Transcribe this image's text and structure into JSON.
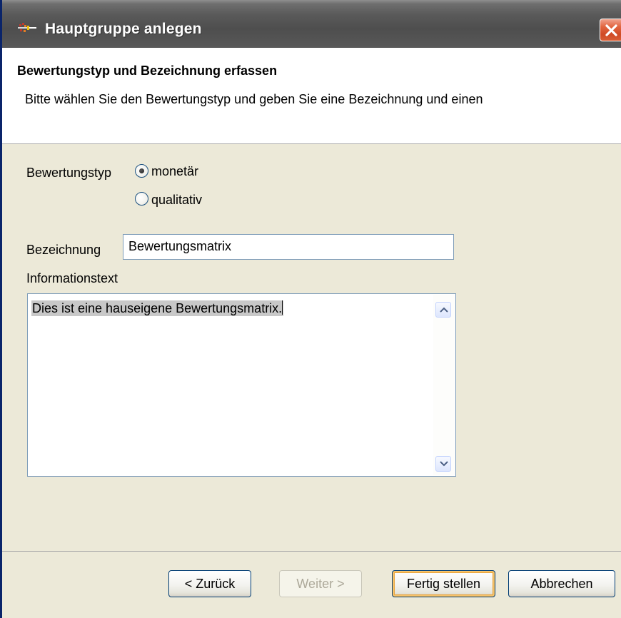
{
  "window": {
    "title": "Hauptgruppe anlegen",
    "close_glyph": "✕"
  },
  "header": {
    "title": "Bewertungstyp und Bezeichnung erfassen",
    "description": "Bitte wählen Sie den Bewertungstyp und geben Sie eine Bezeichnung und einen"
  },
  "form": {
    "bewertungstyp_label": "Bewertungstyp",
    "options": [
      {
        "label": "monetär",
        "selected": true
      },
      {
        "label": "qualitativ",
        "selected": false
      }
    ],
    "bezeichnung_label": "Bezeichnung",
    "bezeichnung_value": "Bewertungsmatrix",
    "info_label": "Informationstext",
    "info_value": "Dies ist eine hauseigene Bewertungsmatrix."
  },
  "buttons": {
    "back": "< Zurück",
    "next": "Weiter >",
    "finish": "Fertig stellen",
    "cancel": "Abbrechen"
  },
  "icons": {
    "app": "app-icon",
    "close": "close-icon",
    "scroll_up": "chevron-up-icon",
    "scroll_down": "chevron-down-icon"
  },
  "colors": {
    "titlebar": "#5a5a5a",
    "close_button": "#d9552f",
    "dialog_background": "#ece9d8",
    "input_border": "#7f9db9",
    "selection": "#c8c8c8"
  }
}
